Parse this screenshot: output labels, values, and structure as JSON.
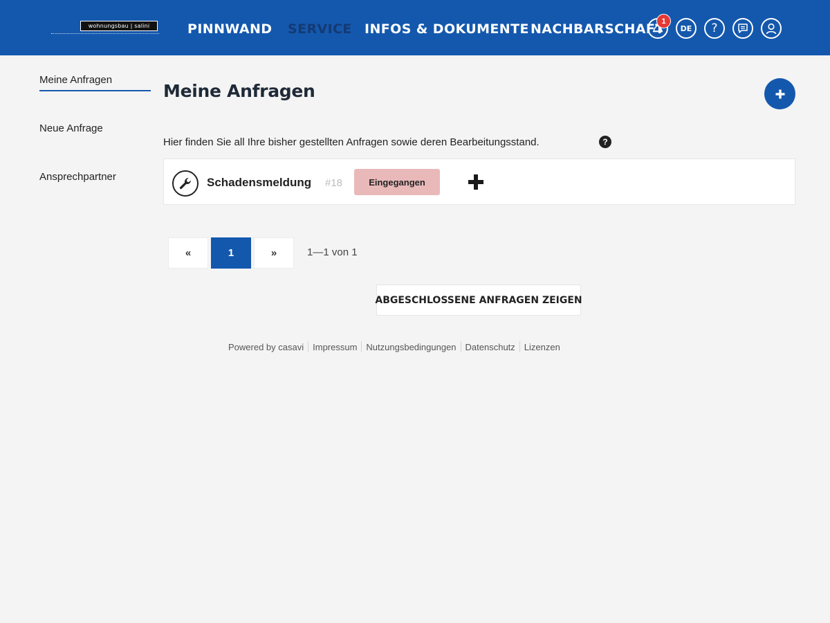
{
  "logo": {
    "text": "wohnungsbau | salini"
  },
  "nav": {
    "items": [
      {
        "label": "PINNWAND",
        "active": false
      },
      {
        "label": "SERVICE",
        "active": true
      },
      {
        "label": "INFOS & DOKUMENTE",
        "active": false
      },
      {
        "label": "NACHBARSCHAFT",
        "active": false
      }
    ],
    "notifications_count": "1",
    "language": "DE",
    "help": "?"
  },
  "colors": {
    "brand": "#1458ad",
    "active_nav": "#143a73",
    "badge": "#e53935",
    "status_received": "#e9b9b9"
  },
  "sidebar": {
    "items": [
      {
        "label": "Meine Anfragen",
        "active": true
      },
      {
        "label": "Neue Anfrage",
        "active": false
      },
      {
        "label": "Ansprechpartner",
        "active": false
      }
    ]
  },
  "main": {
    "title": "Meine Anfragen",
    "intro": "Hier finden Sie all Ihre bisher gestellten Anfragen sowie deren Bearbeitungsstand.",
    "help_icon": "?",
    "requests": [
      {
        "icon": "wrench-icon",
        "title": "Schadensmeldung",
        "number": "#18",
        "status": "Eingegangen"
      }
    ],
    "pagination": {
      "prev": "«",
      "current": "1",
      "next": "»",
      "info": "1—1 von 1"
    },
    "closed_button": "ABGESCHLOSSENE ANFRAGEN ZEIGEN"
  },
  "footer": {
    "links": [
      "Powered by casavi",
      "Impressum",
      "Nutzungsbedingungen",
      "Datenschutz",
      "Lizenzen"
    ]
  }
}
